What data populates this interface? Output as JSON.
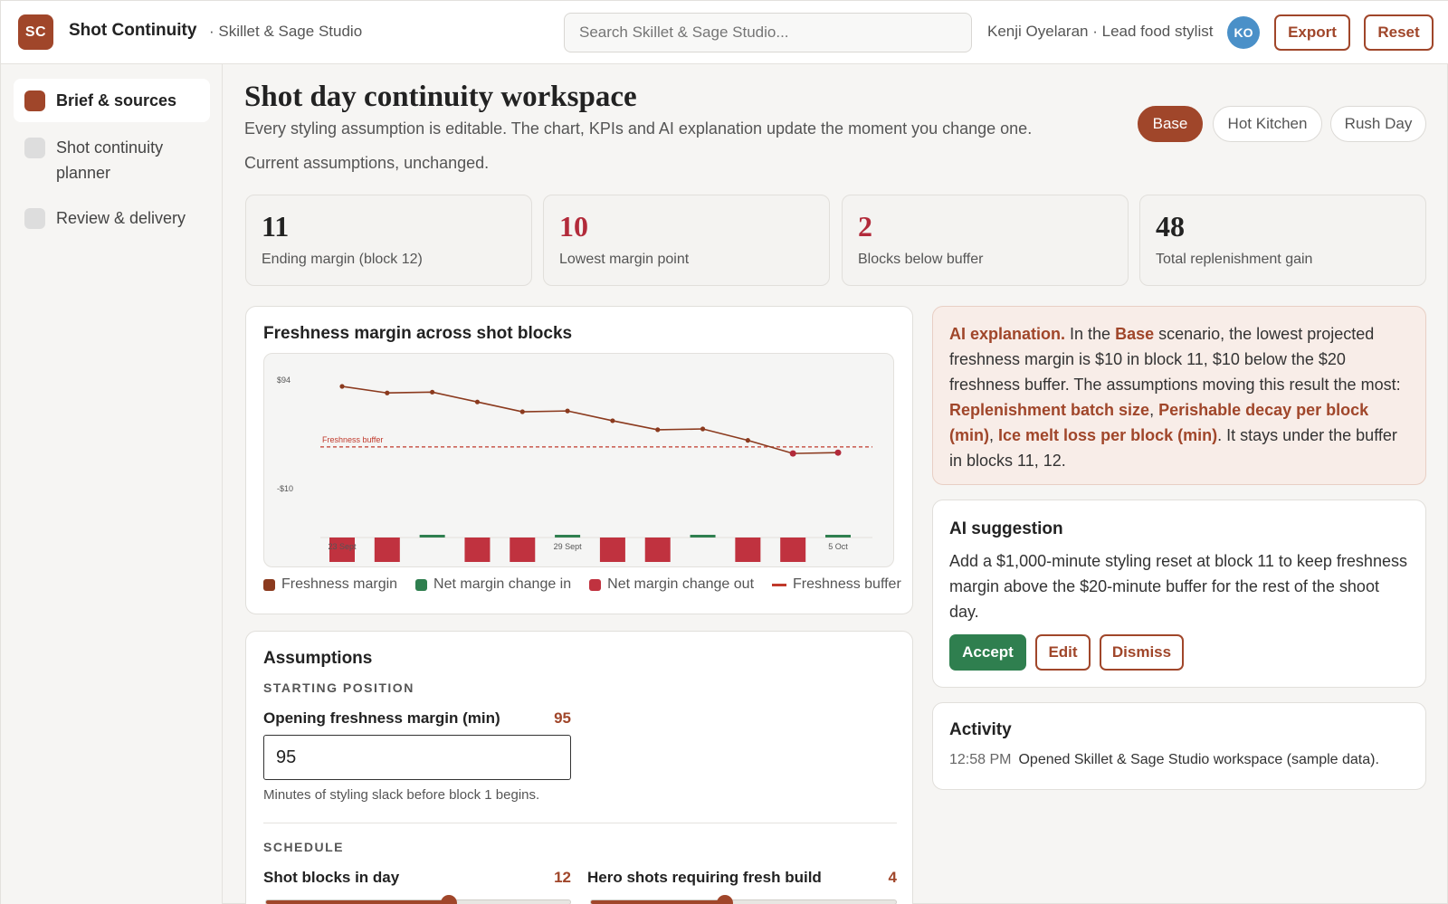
{
  "app": {
    "logo": "SC",
    "title": "Shot Continuity",
    "workspace": "· Skillet & Sage Studio",
    "search_placeholder": "Search Skillet & Sage Studio...",
    "user": "Kenji Oyelaran · Lead food stylist",
    "avatar": "KO",
    "export_label": "Export",
    "reset_label": "Reset"
  },
  "sidebar": {
    "items": [
      {
        "label": "Brief & sources",
        "active": true
      },
      {
        "label": "Shot continuity planner",
        "active": false
      },
      {
        "label": "Review & delivery",
        "active": false
      }
    ]
  },
  "page": {
    "title": "Shot day continuity workspace",
    "subtitle": "Every styling assumption is editable. The chart, KPIs and AI explanation update the moment you change one.",
    "status": "Current assumptions, unchanged.",
    "scenarios": [
      "Base",
      "Hot Kitchen",
      "Rush Day"
    ],
    "active_scenario": "Base"
  },
  "kpis": [
    {
      "value": "11",
      "label": "Ending margin (block 12)",
      "alert": false
    },
    {
      "value": "10",
      "label": "Lowest margin point",
      "alert": true
    },
    {
      "value": "2",
      "label": "Blocks below buffer",
      "alert": true
    },
    {
      "value": "48",
      "label": "Total replenishment gain",
      "alert": false
    }
  ],
  "chart_card": {
    "title": "Freshness margin across shot blocks",
    "legend": [
      "Freshness margin",
      "Net margin change in",
      "Net margin change out",
      "Freshness buffer"
    ]
  },
  "chart_data": {
    "type": "line",
    "title": "Freshness margin across shot blocks",
    "y_tick_labels": [
      "$94",
      "-$10"
    ],
    "x_tick_labels": [
      "23 Sept",
      "29 Sept",
      "5 Oct"
    ],
    "buffer_label": "Freshness buffer",
    "buffer_value": 20,
    "ylim": [
      -10,
      94
    ],
    "series": [
      {
        "name": "Freshness margin",
        "type": "line",
        "values": [
          94,
          86,
          87,
          75,
          63,
          64,
          52,
          41,
          42,
          28,
          12,
          13
        ]
      },
      {
        "name": "Net margin change in",
        "type": "bar",
        "values": [
          0,
          0,
          3,
          0,
          0,
          3,
          0,
          0,
          3,
          0,
          0,
          3
        ]
      },
      {
        "name": "Net margin change out",
        "type": "bar",
        "values": [
          -9,
          -9,
          0,
          -9,
          -9,
          0,
          -9,
          -9,
          0,
          -9,
          -9,
          0
        ]
      }
    ],
    "colors": {
      "line": "#8b3a1e",
      "in": "#2f7f4f",
      "out": "#c0323f",
      "buffer": "#c0392b"
    }
  },
  "ai_explanation": {
    "lead": "AI explanation.",
    "t1": " In the ",
    "scenario": "Base",
    "t2": " scenario, the lowest projected freshness margin is $10 in block 11, $10 below the $20 freshness buffer. The assumptions moving this result the most: ",
    "f1": "Replenishment batch size",
    "sep1": ", ",
    "f2": "Perishable decay per block (min)",
    "sep2": ", ",
    "f3": "Ice melt loss per block (min)",
    "t3": ". It stays under the buffer in blocks 11, 12."
  },
  "ai_suggestion": {
    "title": "AI suggestion",
    "text": "Add a $1,000-minute styling reset at block 11 to keep freshness margin above the $20-minute buffer for the rest of the shoot day.",
    "accept": "Accept",
    "edit": "Edit",
    "dismiss": "Dismiss"
  },
  "activity": {
    "title": "Activity",
    "time": "12:58 PM",
    "text": "Opened Skillet & Sage Studio workspace (sample data)."
  },
  "assumptions": {
    "title": "Assumptions",
    "section1": "STARTING POSITION",
    "opening_label": "Opening freshness margin (min)",
    "opening_value": "95",
    "opening_input": "95",
    "opening_hint": "Minutes of styling slack before block 1 begins.",
    "section2": "SCHEDULE",
    "blocks_label": "Shot blocks in day",
    "blocks_value": "12",
    "blocks_fraction": 0.6,
    "hero_label": "Hero shots requiring fresh build",
    "hero_value": "4",
    "hero_fraction": 0.44
  }
}
